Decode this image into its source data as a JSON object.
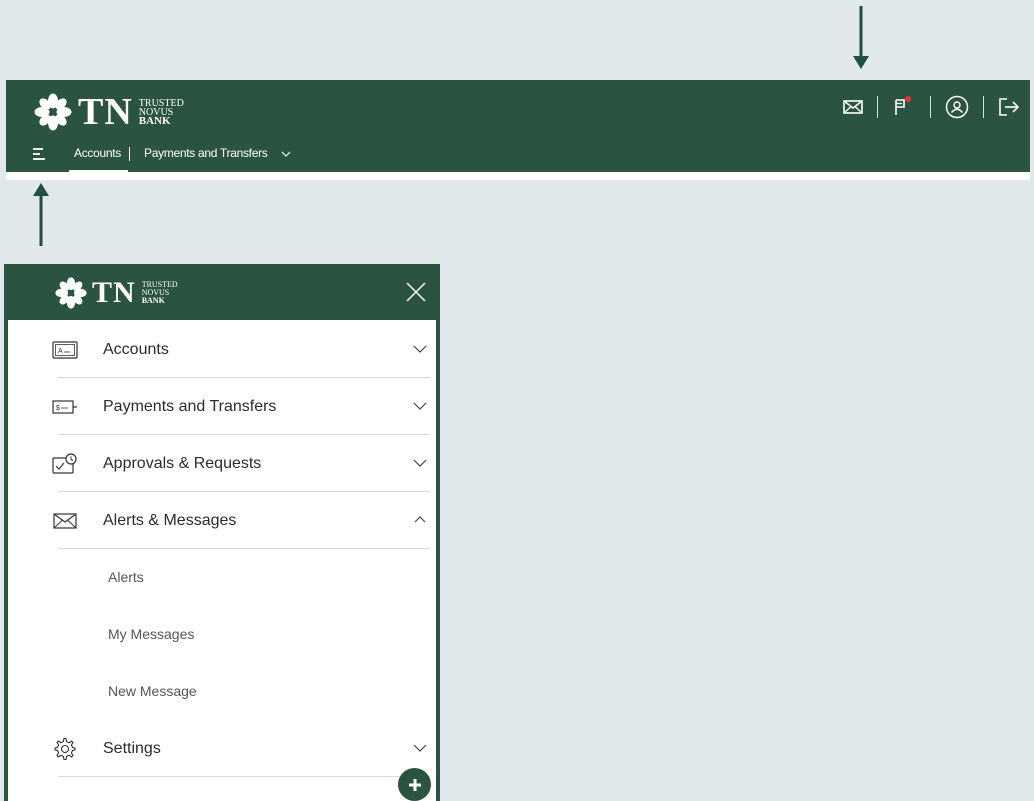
{
  "brand": {
    "initials": "TN",
    "line1": "TRUSTED",
    "line2": "NOVUS",
    "line3": "BANK"
  },
  "header_icons": [
    "envelope-icon",
    "flag-icon",
    "user-circle-icon",
    "logout-icon"
  ],
  "nav": {
    "tabs": [
      {
        "label": "Accounts",
        "active": true
      },
      {
        "label": "Payments and Transfers",
        "active": false
      }
    ]
  },
  "side_menu": {
    "items": [
      {
        "label": "Accounts",
        "icon": "account-card-icon",
        "expanded": false
      },
      {
        "label": "Payments and Transfers",
        "icon": "payment-icon",
        "expanded": false
      },
      {
        "label": "Approvals & Requests",
        "icon": "approvals-icon",
        "expanded": false
      },
      {
        "label": "Alerts & Messages",
        "icon": "envelope-icon",
        "expanded": true,
        "children": [
          "Alerts",
          "My Messages",
          "New Message"
        ]
      },
      {
        "label": "Settings",
        "icon": "gear-icon",
        "expanded": false
      }
    ]
  },
  "colors": {
    "brand_green": "#2b5341",
    "background": "#e1e8eb",
    "notification_red": "#e8342a"
  }
}
